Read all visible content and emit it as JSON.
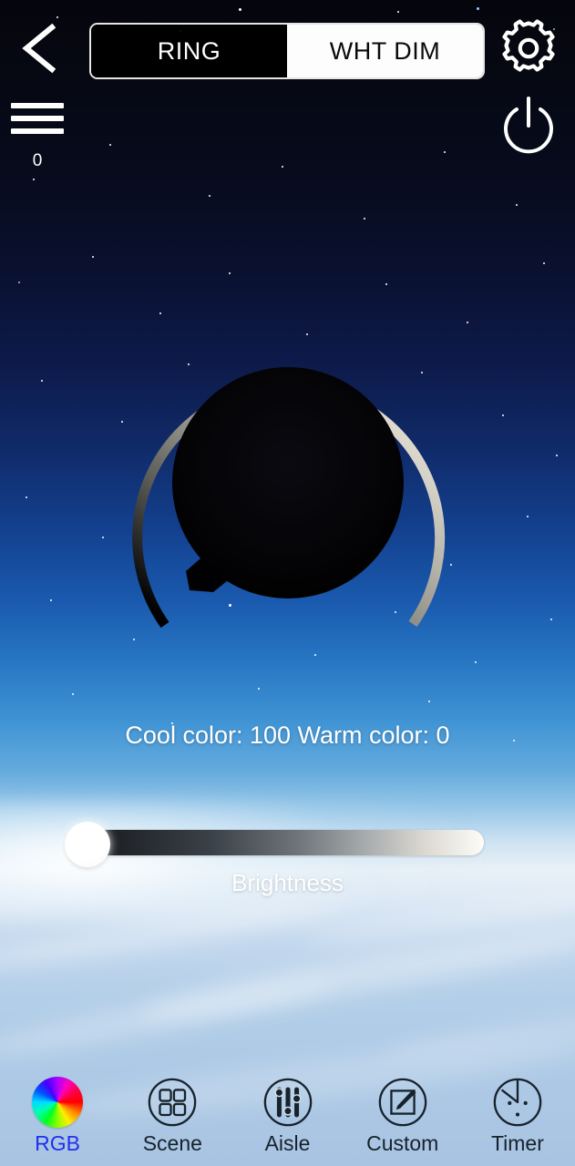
{
  "app": {
    "mode_toggle": {
      "options": [
        {
          "label": "RING",
          "selected": false
        },
        {
          "label": "WHT DIM",
          "selected": true
        }
      ]
    },
    "menu_value": "0"
  },
  "header": {
    "back_icon": "chevron-left-icon",
    "menu_icon": "hamburger-icon",
    "settings_icon": "gear-icon",
    "power_icon": "power-icon"
  },
  "dial": {
    "cool_label": "Cool color",
    "cool_value": 100,
    "warm_label": "Warm color",
    "warm_value": 0,
    "readout": "Cool color: 100 Warm color: 0",
    "arc_start_color": "#0a0a0a",
    "arc_end_color": "#e9e3d8",
    "inner_color": "#030305"
  },
  "brightness": {
    "label": "Brightness",
    "value": 0,
    "min": 0,
    "max": 100,
    "track_start_color": "#15181c",
    "track_end_color": "#fdfcf7",
    "thumb_color": "#ffffff"
  },
  "tabbar": {
    "active_color": "#2030ee",
    "inactive_color": "#17222b",
    "items": [
      {
        "label": "RGB",
        "icon": "color-wheel-icon",
        "active": true
      },
      {
        "label": "Scene",
        "icon": "grid-squares-icon",
        "active": false
      },
      {
        "label": "Aisle",
        "icon": "sliders-icon",
        "active": false
      },
      {
        "label": "Custom",
        "icon": "pencil-square-icon",
        "active": false
      },
      {
        "label": "Timer",
        "icon": "timer-icon",
        "active": false
      }
    ]
  }
}
